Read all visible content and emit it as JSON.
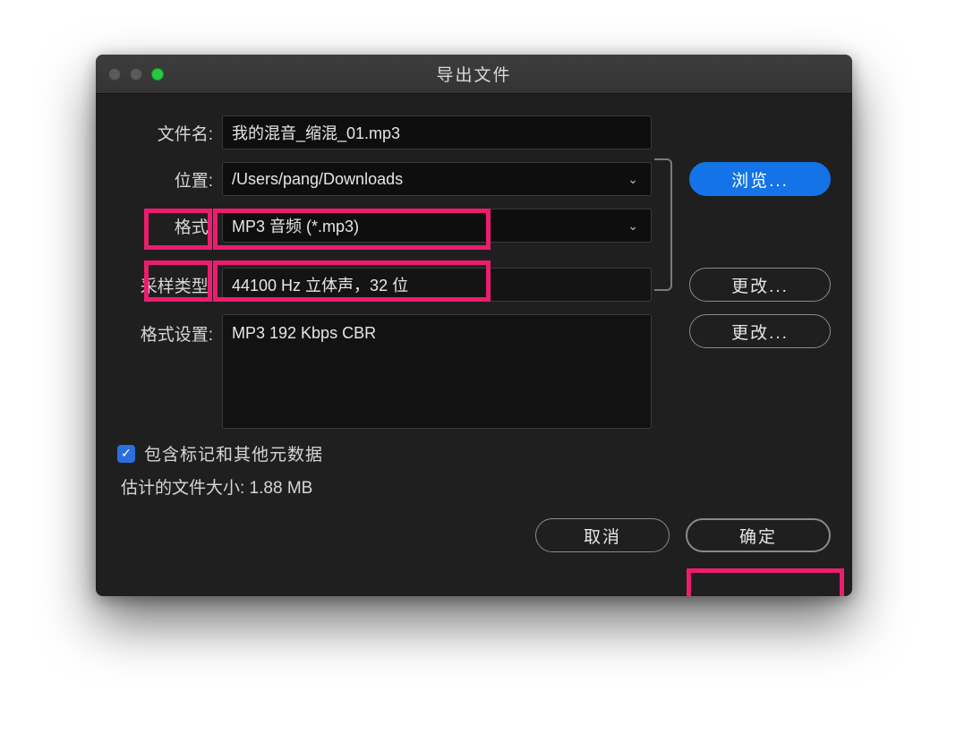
{
  "titlebar": {
    "title": "导出文件"
  },
  "labels": {
    "filename": "文件名:",
    "location": "位置:",
    "format": "格式:",
    "sample_type": "采样类型:",
    "format_settings": "格式设置:"
  },
  "fields": {
    "filename": "我的混音_缩混_01.mp3",
    "location": "/Users/pang/Downloads",
    "format": "MP3 音频 (*.mp3)",
    "sample_type": "44100 Hz 立体声，32 位",
    "format_settings": "MP3 192 Kbps CBR"
  },
  "buttons": {
    "browse": "浏览...",
    "change1": "更改...",
    "change2": "更改...",
    "cancel": "取消",
    "ok": "确定"
  },
  "checkbox": {
    "include_metadata": "包含标记和其他元数据",
    "checked": true
  },
  "filesize": "估计的文件大小: 1.88 MB",
  "icons": {
    "chevron_down": "⌄",
    "checkmark": "✓"
  }
}
